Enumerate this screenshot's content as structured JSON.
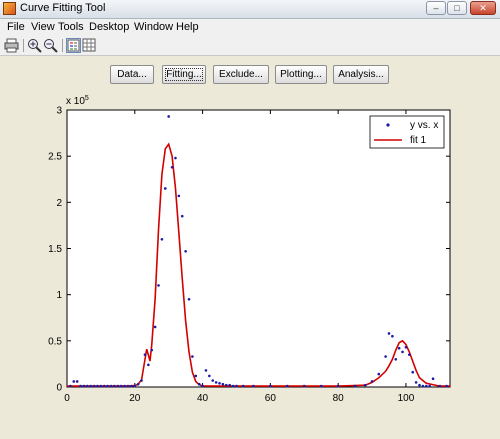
{
  "window": {
    "title": "Curve Fitting Tool"
  },
  "menu": [
    "File",
    "View",
    "Tools",
    "Desktop",
    "Window",
    "Help"
  ],
  "toolbar": {
    "icons": [
      "print-icon",
      "zoom-in-icon",
      "zoom-out-icon",
      "legend-icon",
      "grid-icon"
    ]
  },
  "buttons": [
    "Data...",
    "Fitting...",
    "Exclude...",
    "Plotting...",
    "Analysis..."
  ],
  "colors": {
    "data": "#1a1aa6",
    "fit": "#d40000"
  },
  "chart_data": {
    "type": "scatter",
    "xlim": [
      0,
      113
    ],
    "ylim": [
      0,
      300000
    ],
    "y_exponent_label": "x 10",
    "y_exponent": "5",
    "x_ticks": [
      0,
      20,
      40,
      60,
      80,
      100
    ],
    "y_ticks": [
      0,
      0.5,
      1,
      1.5,
      2,
      2.5,
      3
    ],
    "legend": {
      "position": "top-right",
      "entries": [
        "y vs. x",
        "fit 1"
      ]
    },
    "series": [
      {
        "name": "y vs. x",
        "style": "points",
        "x": [
          1,
          2,
          3,
          4,
          5,
          6,
          7,
          8,
          9,
          10,
          11,
          12,
          13,
          14,
          15,
          16,
          17,
          18,
          19,
          20,
          21,
          22,
          23,
          24,
          25,
          26,
          27,
          28,
          29,
          30,
          31,
          32,
          33,
          34,
          35,
          36,
          37,
          38,
          39,
          40,
          41,
          42,
          43,
          44,
          45,
          46,
          47,
          48,
          49,
          50,
          52,
          55,
          60,
          65,
          70,
          75,
          80,
          85,
          88,
          90,
          92,
          94,
          95,
          96,
          97,
          98,
          99,
          100,
          101,
          102,
          103,
          104,
          105,
          106,
          107,
          108,
          110,
          112
        ],
        "y": [
          1000,
          6000,
          6000,
          1000,
          1000,
          1000,
          1000,
          1000,
          1000,
          1000,
          1000,
          1000,
          1000,
          1000,
          1000,
          1000,
          1000,
          1000,
          1000,
          1000,
          3000,
          7000,
          35000,
          24000,
          40000,
          65000,
          110000,
          160000,
          215000,
          293000,
          238000,
          248000,
          207000,
          185000,
          147000,
          95000,
          33000,
          12000,
          3000,
          1000,
          18000,
          12000,
          7000,
          5000,
          4000,
          3000,
          2000,
          2000,
          1000,
          1000,
          1000,
          1000,
          1000,
          1000,
          1000,
          1000,
          1000,
          1000,
          2000,
          6000,
          14000,
          33000,
          58000,
          55000,
          30000,
          42000,
          38000,
          43000,
          35000,
          16000,
          5000,
          2000,
          1000,
          1000,
          1000,
          9000,
          1000,
          1000
        ]
      },
      {
        "name": "fit 1",
        "style": "line",
        "x": [
          0,
          10,
          18,
          20,
          21,
          22,
          23,
          23.5,
          24,
          24.5,
          25,
          26,
          27,
          28,
          29,
          30,
          31,
          32,
          33,
          34,
          35,
          36,
          37,
          38,
          39,
          40,
          42,
          45,
          60,
          80,
          88,
          90,
          92,
          94,
          95,
          96,
          97,
          98,
          99,
          100,
          101,
          102,
          103,
          104,
          106,
          110,
          113
        ],
        "y": [
          1000,
          1000,
          1000,
          1500,
          3000,
          8000,
          30000,
          41000,
          35000,
          28000,
          45000,
          95000,
          170000,
          230000,
          258000,
          263000,
          250000,
          215000,
          168000,
          118000,
          72000,
          38000,
          16000,
          6000,
          2500,
          1200,
          1000,
          1000,
          1000,
          1000,
          2000,
          5000,
          10000,
          17000,
          23000,
          30000,
          40000,
          48000,
          50000,
          46000,
          38000,
          28000,
          18000,
          10000,
          4000,
          1000,
          1000
        ]
      }
    ]
  }
}
